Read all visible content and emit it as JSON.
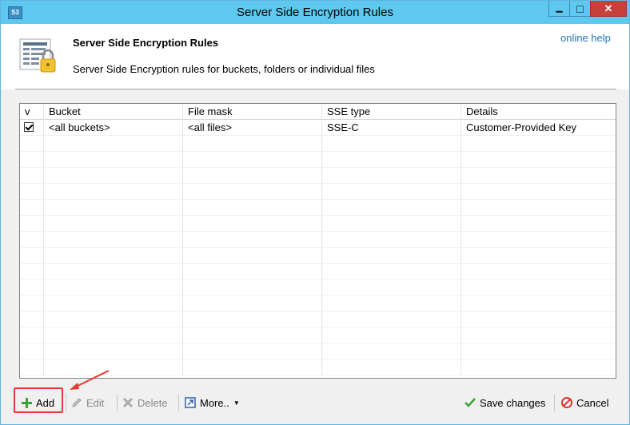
{
  "window": {
    "title": "Server Side Encryption Rules",
    "app_icon_text": "S3",
    "minimize_glyph": "▁",
    "maximize_glyph": "□",
    "close_glyph": "✕"
  },
  "header": {
    "title": "Server Side Encryption Rules",
    "subtitle": "Server Side Encryption rules for buckets, folders or individual files",
    "help_link": "online help",
    "icon": "encryption-rules-lock-icon"
  },
  "table": {
    "columns": [
      "v",
      "Bucket",
      "File mask",
      "SSE type",
      "Details"
    ],
    "rows": [
      {
        "checked": true,
        "bucket": "<all buckets>",
        "file_mask": "<all files>",
        "sse_type": "SSE-C",
        "details": "Customer-Provided Key"
      }
    ]
  },
  "toolbar": {
    "add_label": "Add",
    "edit_label": "Edit",
    "delete_label": "Delete",
    "more_label": "More..",
    "save_label": "Save changes",
    "cancel_label": "Cancel"
  },
  "colors": {
    "titlebar": "#5ec8ee",
    "close_button": "#c7413a",
    "highlight": "#e53935",
    "link": "#2673b8"
  }
}
